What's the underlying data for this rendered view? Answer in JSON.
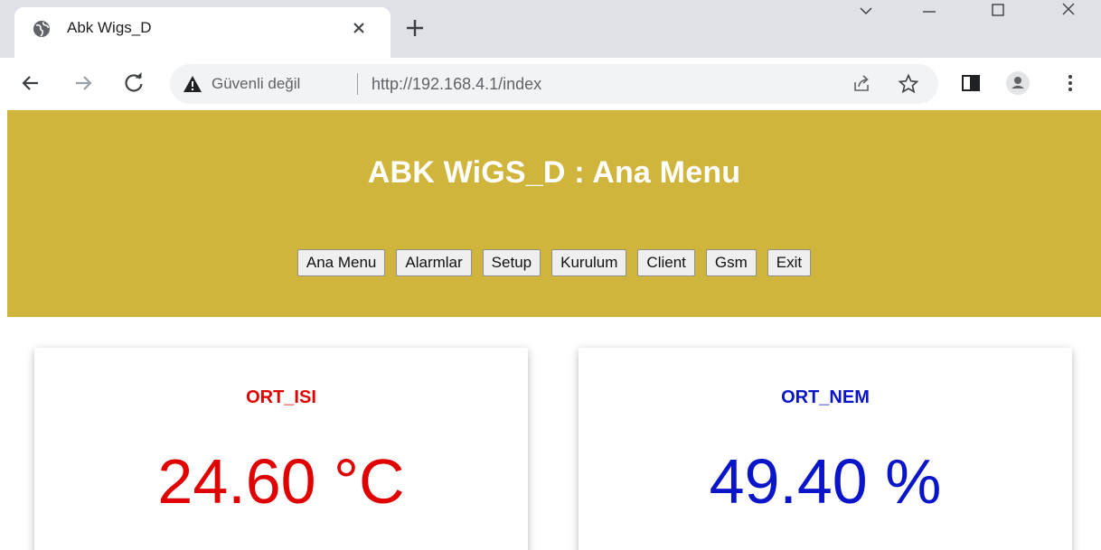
{
  "browser": {
    "tab_title": "Abk Wigs_D",
    "security_label": "Güvenli değil",
    "url": "http://192.168.4.1/index"
  },
  "page": {
    "title": "ABK WiGS_D : Ana Menu",
    "header_color": "#cfb53b",
    "nav": [
      {
        "label": "Ana Menu"
      },
      {
        "label": "Alarmlar"
      },
      {
        "label": "Setup"
      },
      {
        "label": "Kurulum"
      },
      {
        "label": "Client"
      },
      {
        "label": "Gsm"
      },
      {
        "label": "Exit"
      }
    ]
  },
  "cards": [
    {
      "label": "ORT_ISI",
      "value": "24.60 °C",
      "color": "#e00000"
    },
    {
      "label": "ORT_NEM",
      "value": "49.40 %",
      "color": "#0a14c8"
    }
  ]
}
